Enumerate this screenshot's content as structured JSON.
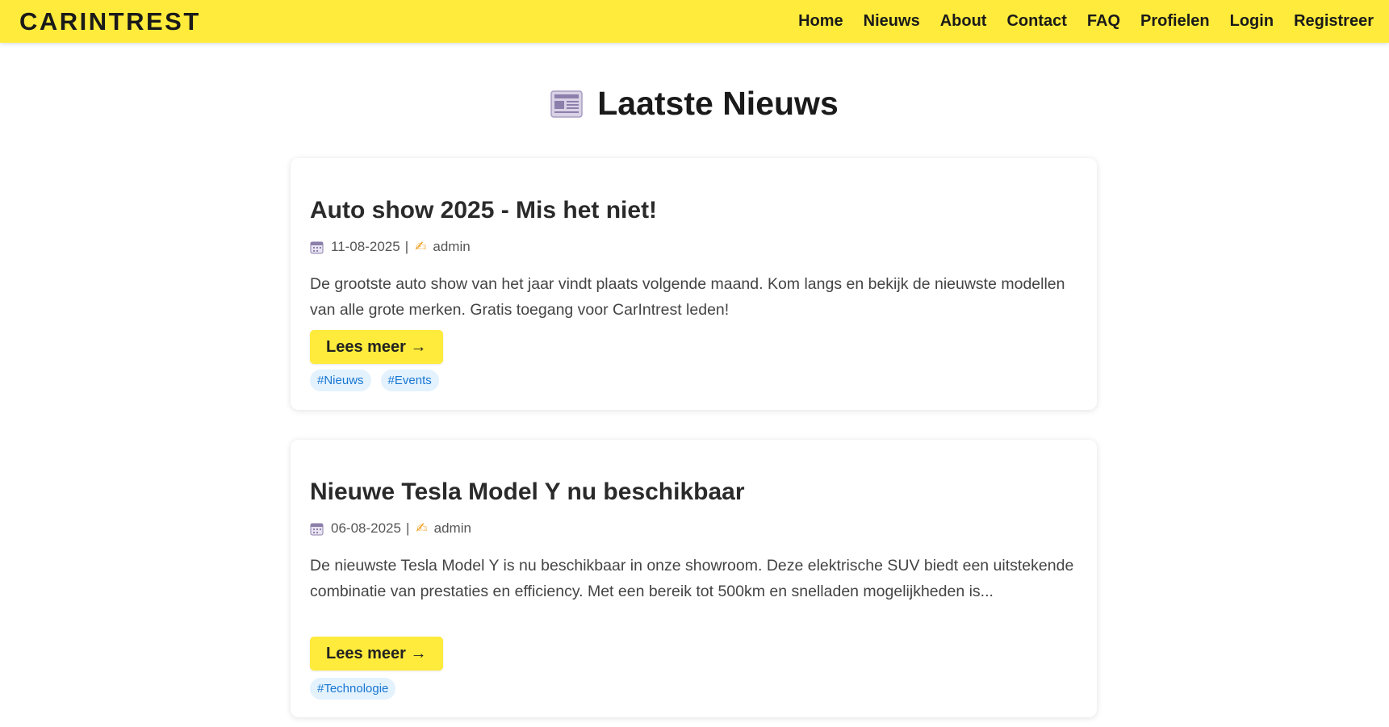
{
  "nav": {
    "brand": "CARINTREST",
    "links": [
      "Home",
      "Nieuws",
      "About",
      "Contact",
      "FAQ",
      "Profielen",
      "Login",
      "Registreer"
    ]
  },
  "page": {
    "title": "Laatste Nieuws",
    "title_icon": "newspaper-icon"
  },
  "articles": [
    {
      "title": "Auto show 2025 - Mis het niet!",
      "date": "11-08-2025",
      "separator": "|",
      "author": "admin",
      "excerpt": "De grootste auto show van het jaar vindt plaats volgende maand. Kom langs en bekijk de nieuwste modellen van alle grote merken. Gratis toegang voor CarIntrest leden!",
      "button": "Lees meer →",
      "tags": [
        "#Nieuws",
        "#Events"
      ]
    },
    {
      "title": "Nieuwe Tesla Model Y nu beschikbaar",
      "date": "06-08-2025",
      "separator": "|",
      "author": "admin",
      "excerpt": "De nieuwste Tesla Model Y is nu beschikbaar in onze showroom. Deze elektrische SUV biedt een uitstekende combinatie van prestaties en efficiency. Met een bereik tot 500km en snelladen mogelijkheden is...",
      "button": "Lees meer →",
      "tags": [
        "#Technologie"
      ]
    }
  ],
  "colors": {
    "accent": "#ffeb3b",
    "tag_bg": "#e3f2fd",
    "tag_text": "#1976d2"
  }
}
